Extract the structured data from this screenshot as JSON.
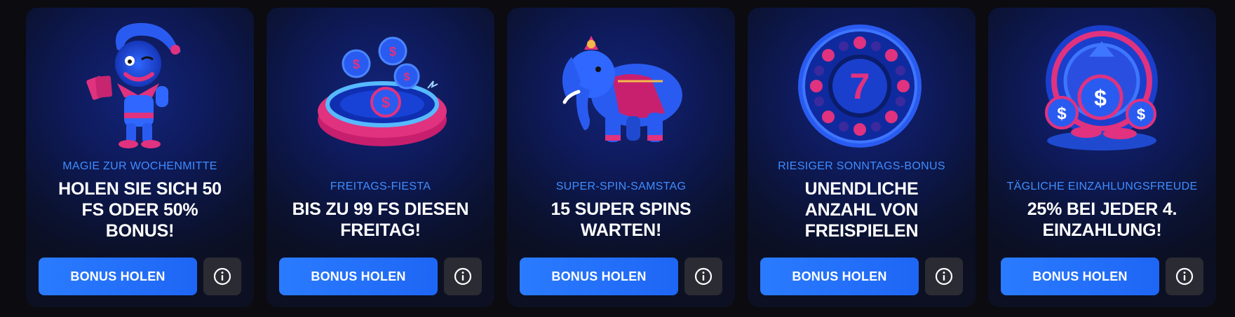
{
  "cards": [
    {
      "subtitle": "MAGIE ZUR WOCHENMITTE",
      "title_lines": [
        "HOLEN SIE SICH 50",
        "FS ODER 50%",
        "BONUS!"
      ],
      "button_label": "BONUS HOLEN",
      "image_icon": "jester-icon"
    },
    {
      "subtitle": "FREITAGS-FIESTA",
      "title_lines": [
        "BIS ZU 99 FS DIESEN",
        "FREITAG!"
      ],
      "button_label": "BONUS HOLEN",
      "image_icon": "coin-portal-icon"
    },
    {
      "subtitle": "SUPER-SPIN-SAMSTAG",
      "title_lines": [
        "15 SUPER SPINS",
        "WARTEN!"
      ],
      "button_label": "BONUS HOLEN",
      "image_icon": "elephant-icon"
    },
    {
      "subtitle": "RIESIGER SONNTAGS-BONUS",
      "title_lines": [
        "UNENDLICHE",
        "ANZAHL VON",
        "FREISPIELEN"
      ],
      "button_label": "BONUS HOLEN",
      "image_icon": "slot-wheel-7-icon",
      "wheel_symbol": "7"
    },
    {
      "subtitle": "TÄGLICHE EINZAHLUNGSFREUDE",
      "title_lines": [
        "25% BEI JEDER 4.",
        "EINZAHLUNG!"
      ],
      "button_label": "BONUS HOLEN",
      "image_icon": "deposit-coins-icon"
    }
  ],
  "colors": {
    "accent_blue": "#2a7bff",
    "subtitle_blue": "#3f8dff",
    "magenta": "#e0327f",
    "info_button_bg": "#2a2b33"
  }
}
